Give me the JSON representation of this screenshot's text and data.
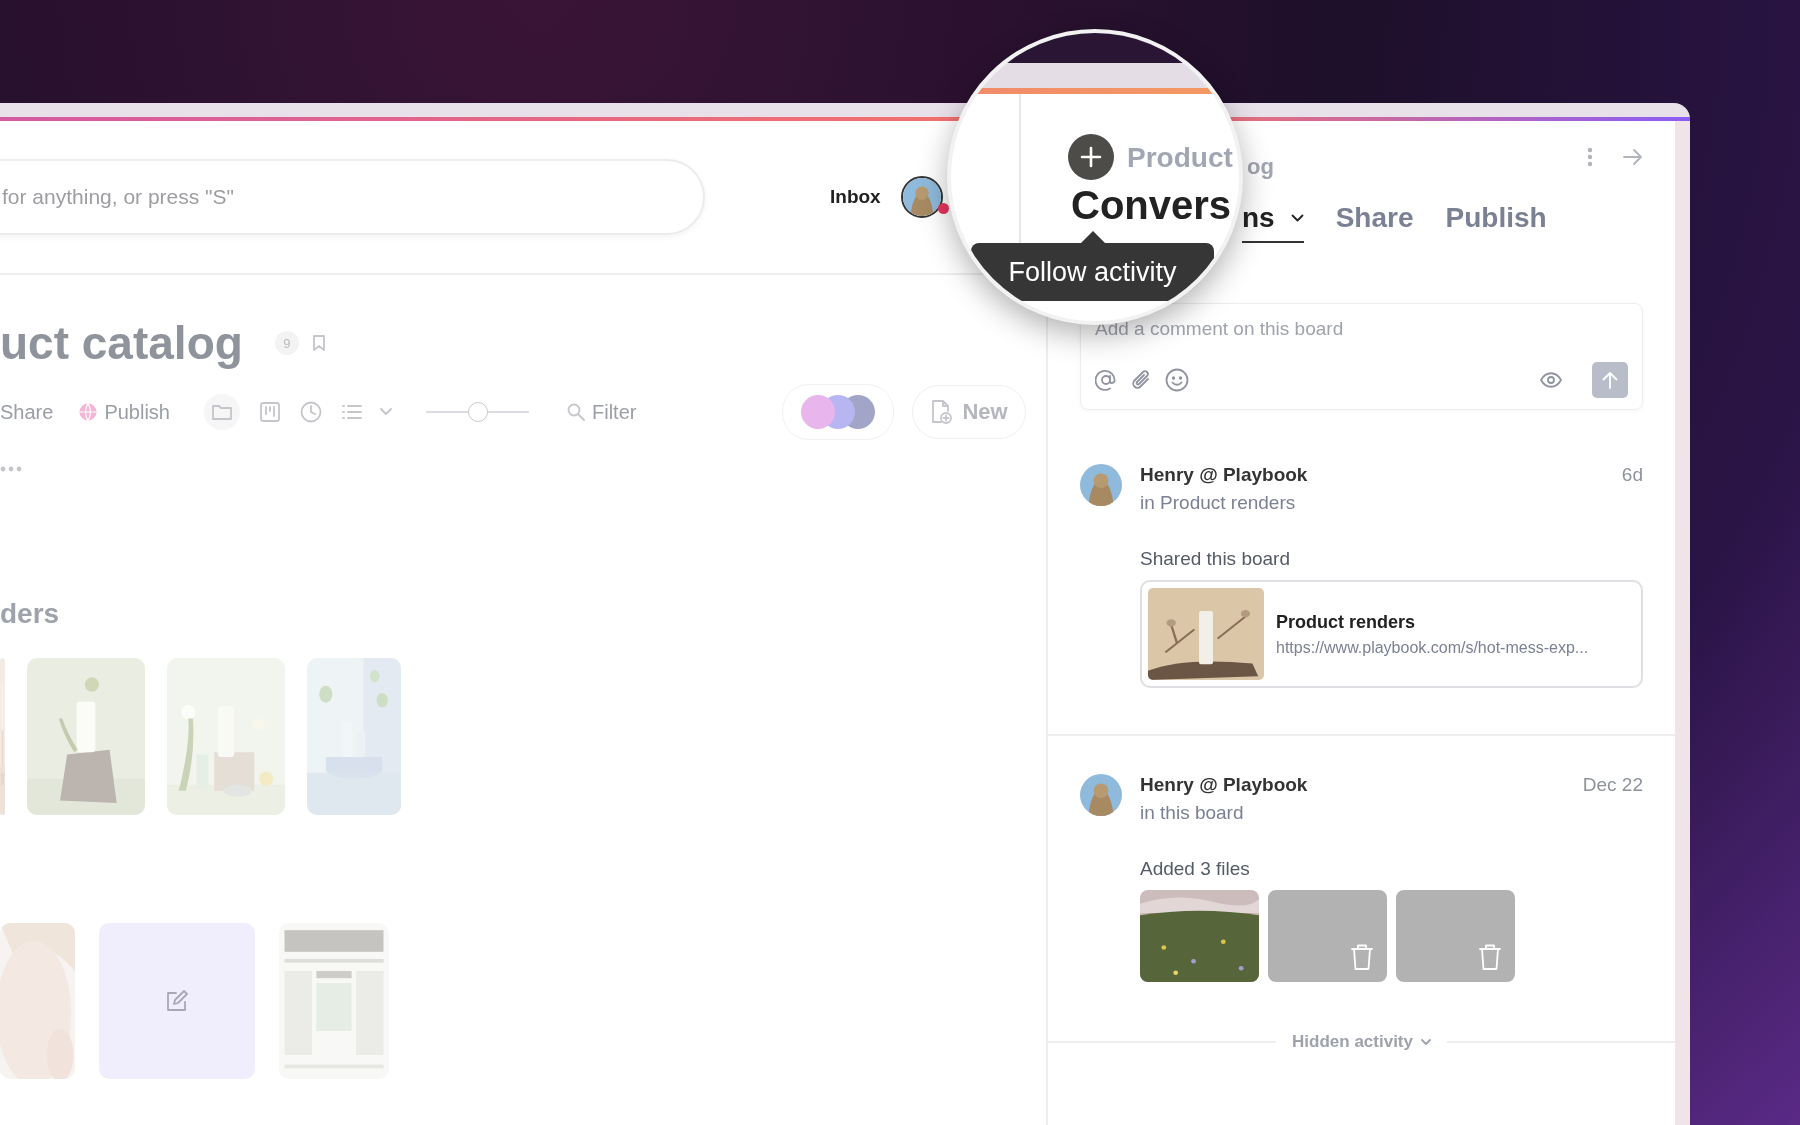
{
  "header": {
    "search": {
      "placeholder": "for anything, or press \"S\""
    },
    "inbox": "Inbox",
    "unread": true
  },
  "board": {
    "title": "uct catalog",
    "count": "9",
    "actions": [
      {
        "label": "Share",
        "kind": "plain"
      },
      {
        "label": "Publish",
        "kind": "globe"
      }
    ],
    "zoom": {
      "level": 0.5
    },
    "filter": "Filter",
    "new_button": "New",
    "sections": [
      {
        "title": "ders",
        "items": [
          {
            "kind": "picture"
          },
          {
            "kind": "picture"
          },
          {
            "kind": "picture"
          },
          {
            "kind": "picture"
          }
        ]
      },
      {
        "items": [
          {
            "kind": "picture"
          },
          {
            "kind": "note"
          },
          {
            "kind": "picture"
          }
        ]
      }
    ]
  },
  "magnifier": {
    "title": "Product",
    "tab": "Convers",
    "tooltip": "Follow activity"
  },
  "panel": {
    "title": "og",
    "tabs": [
      {
        "label": "ns",
        "selected": true,
        "dropdown": true
      },
      {
        "label": "Share",
        "selected": false,
        "dropdown": false
      },
      {
        "label": "Publish",
        "selected": false,
        "dropdown": false
      }
    ],
    "comment": {
      "placeholder": "Add a comment on this board"
    },
    "activity": [
      {
        "author": "Henry @ Playbook",
        "context": "in Product renders",
        "time": "6d",
        "action": "Shared this board",
        "kind": "link",
        "link": {
          "title": "Product renders",
          "url": "https://www.playbook.com/s/hot-mess-exp..."
        }
      },
      {
        "author": "Henry @ Playbook",
        "context": "in this board",
        "time": "Dec 22",
        "action": "Added 3 files",
        "kind": "files",
        "files": [
          {
            "kind": "picture"
          },
          {
            "kind": "deleted"
          },
          {
            "kind": "deleted"
          }
        ]
      }
    ],
    "hidden_activity": "Hidden activity"
  }
}
